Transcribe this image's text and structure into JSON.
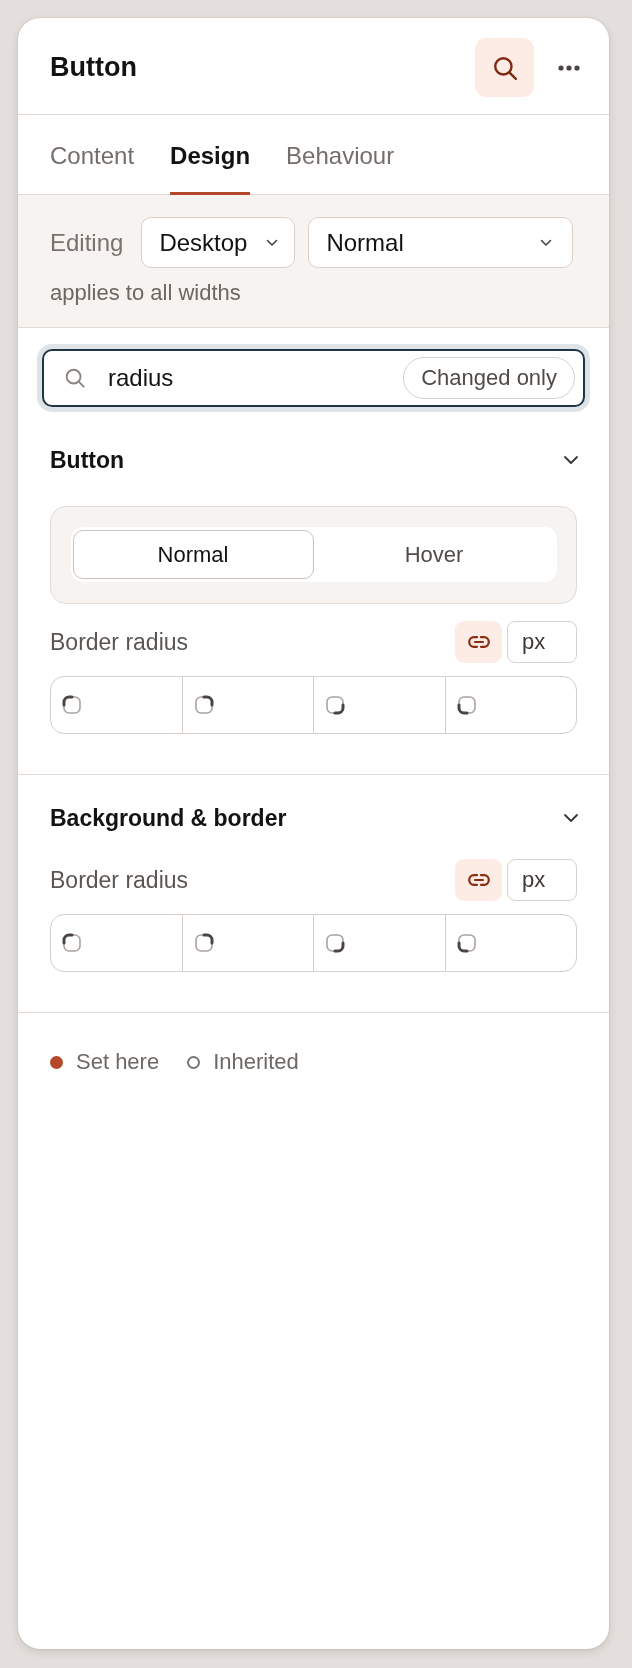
{
  "header": {
    "title": "Button",
    "search_active": true
  },
  "tabs": [
    {
      "label": "Content",
      "selected": false
    },
    {
      "label": "Design",
      "selected": true
    },
    {
      "label": "Behaviour",
      "selected": false
    }
  ],
  "editing": {
    "label": "Editing",
    "device": "Desktop",
    "state": "Normal",
    "note": "applies to all widths"
  },
  "search": {
    "value": "radius",
    "focused": true,
    "filter": {
      "label": "Changed only",
      "on": false
    }
  },
  "sections": [
    {
      "title": "Button",
      "expanded": true,
      "state_tabs": [
        {
          "label": "Normal",
          "selected": true
        },
        {
          "label": "Hover",
          "selected": false
        }
      ],
      "fields": [
        {
          "label": "Border radius",
          "linked": true,
          "unit": "px"
        }
      ]
    },
    {
      "title": "Background & border",
      "expanded": true,
      "fields": [
        {
          "label": "Border radius",
          "linked": true,
          "unit": "px"
        }
      ]
    }
  ],
  "legend": [
    {
      "label": "Set here",
      "kind": "set",
      "color": "#b5472a"
    },
    {
      "label": "Inherited",
      "kind": "inherited",
      "color": "#7a7370"
    }
  ]
}
